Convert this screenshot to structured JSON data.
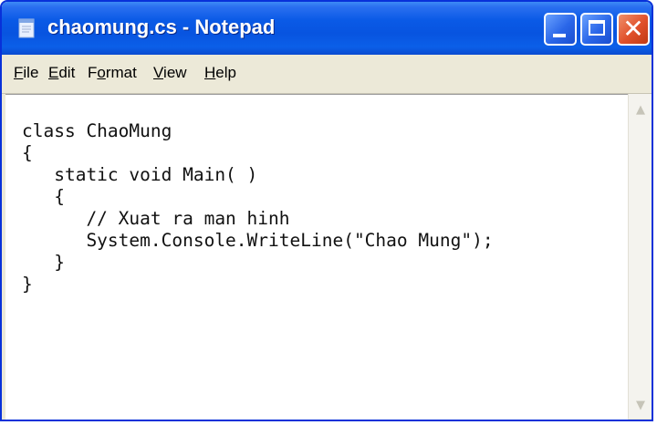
{
  "window": {
    "title": "chaomung.cs - Notepad"
  },
  "menu": {
    "file": {
      "mnemonic": "F",
      "rest": "ile"
    },
    "edit": {
      "mnemonic": "E",
      "rest": "dit"
    },
    "format": {
      "pre": "F",
      "mnemonic": "o",
      "rest": "rmat"
    },
    "view": {
      "mnemonic": "V",
      "rest": "iew"
    },
    "help": {
      "mnemonic": "H",
      "rest": "elp"
    }
  },
  "editor": {
    "lines": [
      "class ChaoMung",
      "{",
      "   static void Main( )",
      "   {",
      "      // Xuat ra man hinh",
      "      System.Console.WriteLine(\"Chao Mung\");",
      "   }",
      "}"
    ]
  },
  "icons": {
    "app": "notepad-icon",
    "minimize": "minimize-icon",
    "maximize": "maximize-icon",
    "close": "close-icon",
    "scroll_up": "scroll-up-arrow-icon",
    "scroll_down": "scroll-down-arrow-icon"
  },
  "colors": {
    "titlebar": "#0854e0",
    "close_button": "#e0502a",
    "menubar": "#ece9d8",
    "editor_bg": "#ffffff"
  }
}
